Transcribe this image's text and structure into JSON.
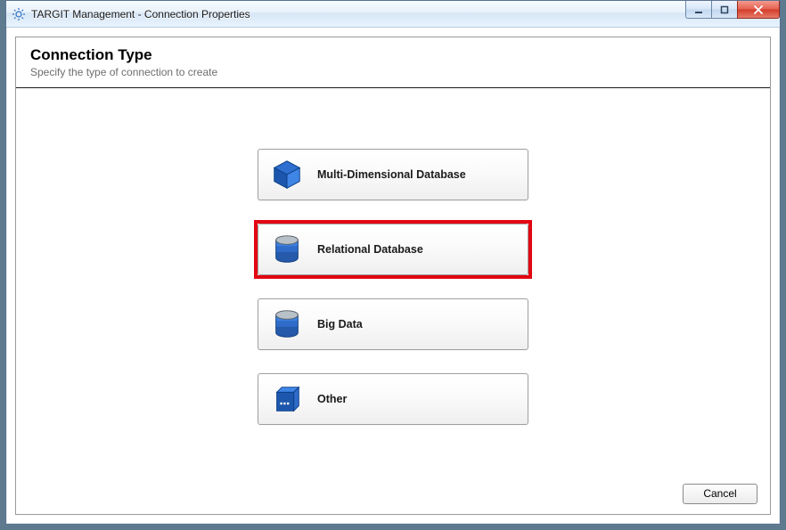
{
  "window": {
    "title": "TARGIT Management - Connection Properties"
  },
  "header": {
    "title": "Connection Type",
    "subtitle": "Specify the type of connection to create"
  },
  "options": {
    "multi_dimensional": {
      "label": "Multi-Dimensional Database",
      "highlighted": false
    },
    "relational": {
      "label": "Relational Database",
      "highlighted": true
    },
    "big_data": {
      "label": "Big Data",
      "highlighted": false
    },
    "other": {
      "label": "Other",
      "highlighted": false
    }
  },
  "footer": {
    "cancel_label": "Cancel"
  }
}
